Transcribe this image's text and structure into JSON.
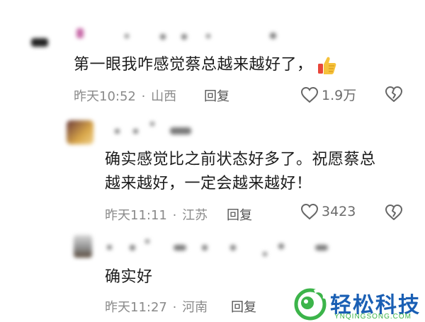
{
  "comments": [
    {
      "text": "第一眼我咋感觉蔡总越来越好了，",
      "time": "昨天10:52",
      "location": "山西",
      "reply_label": "回复",
      "likes": "1.9万"
    },
    {
      "text_line1": "确实感觉比之前状态好多了。祝愿蔡总",
      "text_line2": "越来越好，一定会越来越好！",
      "time": "昨天11:11",
      "location": "江苏",
      "reply_label": "回复",
      "likes": "3423"
    },
    {
      "text": "确实好",
      "time": "昨天11:27",
      "location": "河南",
      "reply_label": "回复"
    }
  ],
  "separator": "·",
  "watermark": {
    "brand": "轻松科技",
    "url": "YNQINGSONG.COM"
  },
  "colors": {
    "accent_green": "#3cb44a",
    "brand_blue": "#1a5fb4",
    "meta_gray": "#8a8a8a"
  }
}
